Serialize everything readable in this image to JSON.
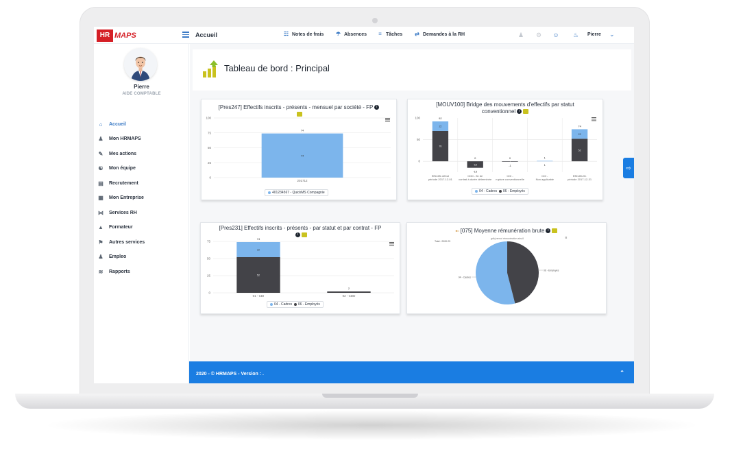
{
  "topbar": {
    "logo_hr": "HR",
    "logo_maps": "MAPS",
    "title": "Accueil",
    "nav": [
      {
        "label": "Notes de frais",
        "icon": "receipt-icon"
      },
      {
        "label": "Absences",
        "icon": "beach-umbrella-icon"
      },
      {
        "label": "Tâches",
        "icon": "tasks-icon"
      },
      {
        "label": "Demandes à la RH",
        "icon": "exchange-icon"
      }
    ],
    "user": "Pierre"
  },
  "profile": {
    "name": "Pierre",
    "role": "AIDE COMPTABLE"
  },
  "sidebar": {
    "items": [
      {
        "label": "Accueil",
        "icon": "home-icon",
        "active": true
      },
      {
        "label": "Mon HRMAPS",
        "icon": "user-icon"
      },
      {
        "label": "Mes actions",
        "icon": "pencil-icon"
      },
      {
        "label": "Mon équipe",
        "icon": "team-icon"
      },
      {
        "label": "Recrutement",
        "icon": "briefcase-icon"
      },
      {
        "label": "Mon Entreprise",
        "icon": "building-icon"
      },
      {
        "label": "Services RH",
        "icon": "share-icon"
      },
      {
        "label": "Formateur",
        "icon": "graduation-cap-icon"
      },
      {
        "label": "Autres services",
        "icon": "tag-icon"
      },
      {
        "label": "Empleo",
        "icon": "people-icon"
      },
      {
        "label": "Rapports",
        "icon": "line-chart-icon"
      }
    ]
  },
  "page": {
    "title": "Tableau de bord : Principal"
  },
  "colors": {
    "accent": "#1a7de2",
    "logo_red": "#d51f26",
    "cadres": "#7cb5ec",
    "employes": "#434348",
    "badge": "#c9c21f"
  },
  "cards": {
    "c1": {
      "title": "[Pres247] Effectifs inscrits - présents - mensuel par société - FP"
    },
    "c2": {
      "title": "[MOUV100] Bridge des mouvements d'effectifs par statut conventionnel"
    },
    "c3": {
      "title": "[Pres231] Effectifs inscrits - présents - par statut et par contrat - FP"
    },
    "c4": {
      "title": "[075] Moyenne rémunération brute"
    }
  },
  "chart_data": [
    {
      "type": "bar",
      "title": "[Pres247] Effectifs inscrits - présents - mensuel par société - FP",
      "categories": [
        "201712"
      ],
      "series": [
        {
          "name": "401234567 - QuickMS Compagnie",
          "values": [
            74
          ]
        }
      ],
      "ylim": [
        0,
        100
      ],
      "yticks": [
        0,
        25,
        50,
        75,
        100
      ],
      "data_labels": [
        "74",
        "74"
      ],
      "legend": "bottom"
    },
    {
      "type": "bar",
      "stacked": true,
      "title": "[MOUV100] Bridge des mouvements d'effectifs par statut conventionnel",
      "categories": [
        "Effectifs début période 2017-12-01",
        "CDD - fin de contrat à durée déterminée",
        "CDI - rupture conventionnelle",
        "CDI - Non applicable",
        "Effectifs fin période 2017-12-31"
      ],
      "series": [
        {
          "name": "04 - Cadres",
          "values": [
            22,
            0,
            0,
            1,
            22
          ]
        },
        {
          "name": "06 - Employés",
          "values": [
            70,
            -15,
            -1,
            0,
            52
          ]
        }
      ],
      "totals": [
        "92",
        "0",
        "0",
        "1",
        "74"
      ],
      "below_labels": [
        "",
        "-16",
        "-1",
        "1",
        ""
      ],
      "ylim": [
        -25,
        100
      ],
      "yticks": [
        0,
        50
      ],
      "legend": "bottom"
    },
    {
      "type": "bar",
      "stacked": true,
      "title": "[Pres231] Effectifs inscrits - présents - par statut et par contrat - FP",
      "categories": [
        "01 - CDI",
        "02 - CDD"
      ],
      "series": [
        {
          "name": "04 - Cadres",
          "values": [
            22,
            0
          ]
        },
        {
          "name": "06 - Employés",
          "values": [
            52,
            2
          ]
        }
      ],
      "totals": [
        "74",
        "2"
      ],
      "ylim": [
        0,
        75
      ],
      "yticks": [
        0,
        25,
        50,
        75
      ],
      "legend": "bottom"
    },
    {
      "type": "pie",
      "title": "[075] Moyenne rémunération brute",
      "subtitle": "gdbj renvoi rémunération abs.6",
      "total_label": "Total : 2000.23",
      "slices": [
        {
          "name": "04 - Cadres",
          "value": 54
        },
        {
          "name": "06 - Employés",
          "value": 46
        }
      ],
      "slice_labels": [
        "06 - Employés",
        "04 - Cadres"
      ]
    }
  ],
  "footer": {
    "text": "2020 - © HRMAPS - Version : ."
  }
}
